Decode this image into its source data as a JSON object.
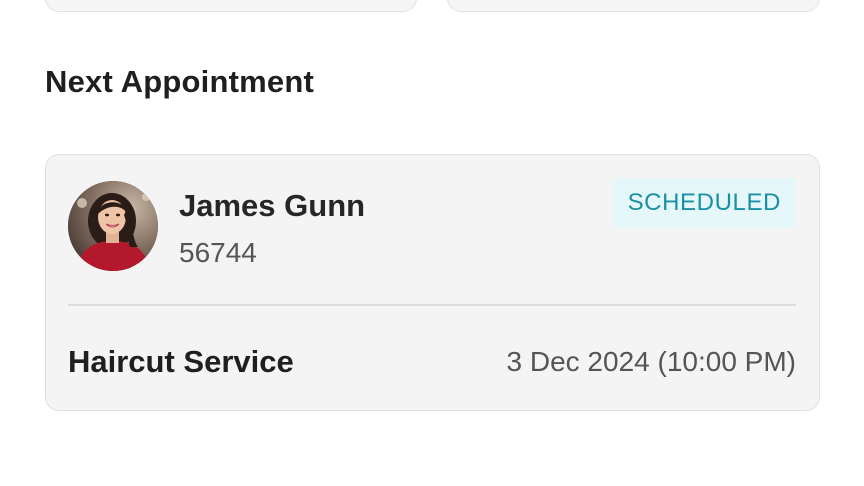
{
  "section": {
    "title": "Next Appointment"
  },
  "appointment": {
    "client_name": "James Gunn",
    "client_id": "56744",
    "status": "SCHEDULED",
    "service": "Haircut Service",
    "datetime": "3 Dec 2024 (10:00 PM)"
  },
  "colors": {
    "status_text": "#1a8fa8",
    "status_bg": "#e6f7fa",
    "card_bg": "#f4f4f4"
  }
}
